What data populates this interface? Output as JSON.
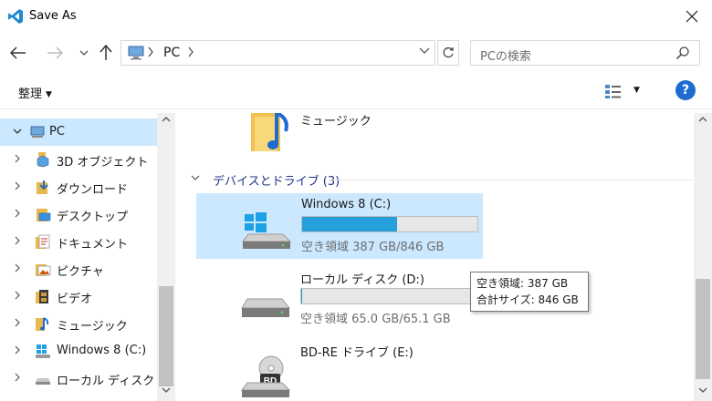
{
  "window": {
    "title": "Save As"
  },
  "address": {
    "crumb": "PC"
  },
  "search": {
    "placeholder": "PCの検索"
  },
  "toolbar": {
    "organize_label": "整理",
    "help_label": "?"
  },
  "tree": [
    {
      "label": "PC",
      "icon": "pc-icon",
      "expanded": true,
      "selected": true
    },
    {
      "label": "3D オブジェクト",
      "icon": "3d-objects-icon"
    },
    {
      "label": "ダウンロード",
      "icon": "downloads-icon"
    },
    {
      "label": "デスクトップ",
      "icon": "desktop-icon"
    },
    {
      "label": "ドキュメント",
      "icon": "documents-icon"
    },
    {
      "label": "ピクチャ",
      "icon": "pictures-icon"
    },
    {
      "label": "ビデオ",
      "icon": "videos-icon"
    },
    {
      "label": "ミュージック",
      "icon": "music-icon"
    },
    {
      "label": "Windows 8 (C:)",
      "icon": "windows-drive-icon"
    },
    {
      "label": "ローカル ディスク (D",
      "icon": "local-disk-icon"
    }
  ],
  "content": {
    "music_folder": "ミュージック",
    "group_header": "デバイスとドライブ (3)",
    "drives": [
      {
        "name": "Windows 8 (C:)",
        "free": "空き領域 387 GB/846 GB",
        "used_fraction": 0.543,
        "selected": true
      },
      {
        "name": "ローカル ディスク (D:)",
        "free": "空き領域 65.0 GB/65.1 GB",
        "used_fraction": 0.0015
      },
      {
        "name": "BD-RE ドライブ (E:)"
      }
    ]
  },
  "tooltip": {
    "line1": "空き領域: 387 GB",
    "line2": "合計サイズ: 846 GB"
  },
  "colors": {
    "selection": "#cce8ff",
    "progress": "#26a0da",
    "group_header": "#1e3287",
    "help": "#1f6cd0"
  }
}
